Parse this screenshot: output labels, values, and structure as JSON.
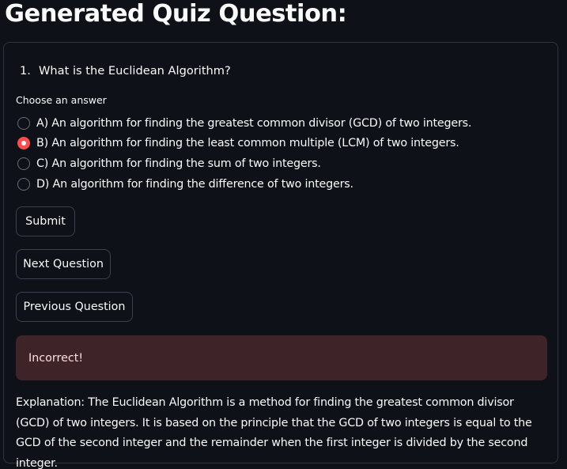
{
  "page": {
    "title": "Generated Quiz Question:"
  },
  "question": {
    "number": "1.",
    "text": "What is the Euclidean Algorithm?"
  },
  "answer_group": {
    "label": "Choose an answer",
    "selected_index": 1,
    "options": [
      {
        "label": "A) An algorithm for finding the greatest common divisor (GCD) of two integers.",
        "selected": false
      },
      {
        "label": "B) An algorithm for finding the least common multiple (LCM) of two integers.",
        "selected": true
      },
      {
        "label": "C) An algorithm for finding the sum of two integers.",
        "selected": false
      },
      {
        "label": "D) An algorithm for finding the difference of two integers.",
        "selected": false
      }
    ]
  },
  "buttons": {
    "submit_label": "Submit",
    "next_label": "Next Question",
    "previous_label": "Previous Question"
  },
  "result": {
    "message": "Incorrect!",
    "status_color": "#3e2428"
  },
  "explanation": {
    "text": "Explanation: The Euclidean Algorithm is a method for finding the greatest common divisor (GCD) of two integers. It is based on the principle that the GCD of two integers is equal to the GCD of the second integer and the remainder when the first integer is divided by the second integer."
  },
  "colors": {
    "background": "#0e1117",
    "accent": "#ff4b4b",
    "text": "#fafafa",
    "border": "#31333f"
  }
}
